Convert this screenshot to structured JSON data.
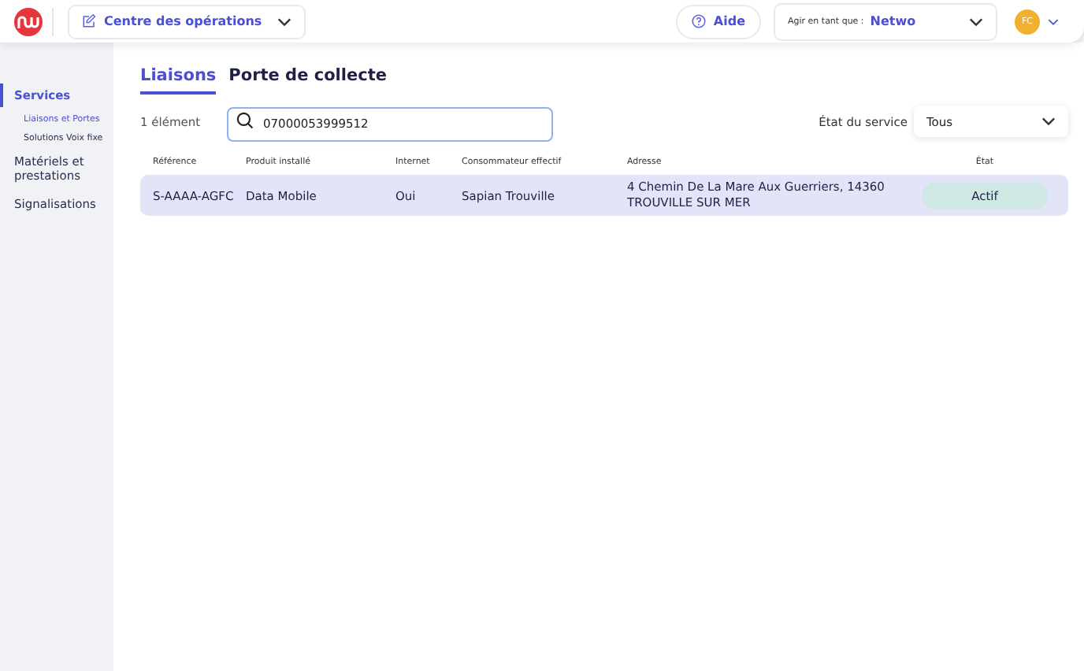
{
  "header": {
    "app_menu": {
      "label": "Centre des opérations"
    },
    "help": {
      "label": "Aide"
    },
    "act_as": {
      "label": "Agir en tant que :",
      "value": "Netwo"
    },
    "avatar": {
      "initials": "FC"
    }
  },
  "sidebar": {
    "items": [
      {
        "label": "Services",
        "selected": true,
        "children": [
          {
            "label": "Liaisons et Portes",
            "selected": true
          },
          {
            "label": "Solutions Voix fixe",
            "selected": false
          }
        ]
      },
      {
        "label": "Matériels et prestations",
        "selected": false
      },
      {
        "label": "Signalisations",
        "selected": false
      }
    ]
  },
  "tabs": [
    {
      "label": "Liaisons",
      "selected": true
    },
    {
      "label": "Porte de collecte",
      "selected": false
    }
  ],
  "count": "1 élément",
  "search": {
    "value": "07000053999512"
  },
  "filter": {
    "label": "État du service",
    "value": "Tous"
  },
  "table": {
    "columns": [
      "Référence",
      "Produit installé",
      "Internet",
      "Consommateur effectif",
      "Adresse",
      "État"
    ],
    "rows": [
      {
        "selected": true,
        "cells": [
          "S-AAAA-AGFC",
          "Data Mobile",
          "Oui",
          "Sapian Trouville",
          "4 Chemin De La Mare Aux Guerriers, 14360 TROUVILLE SUR MER"
        ],
        "status": {
          "label": "Actif",
          "kind": "active"
        }
      }
    ]
  }
}
